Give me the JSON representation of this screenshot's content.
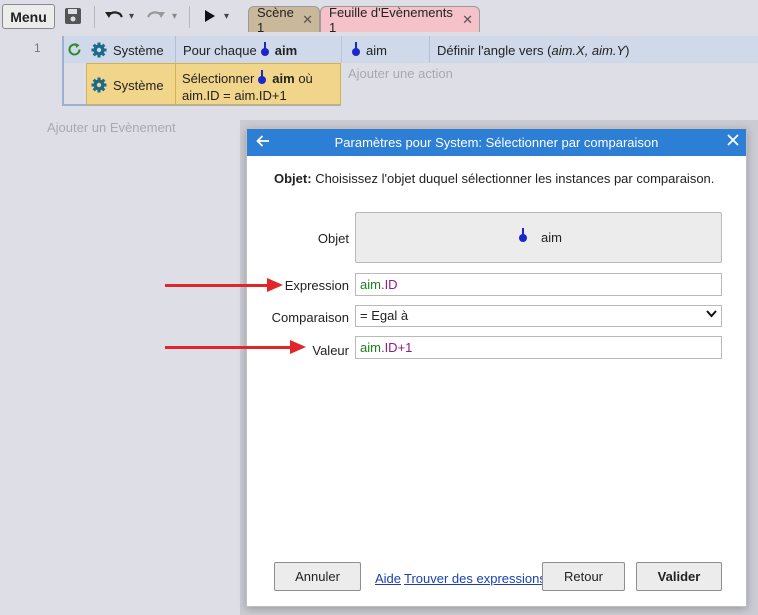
{
  "toolbar": {
    "menu_label": "Menu",
    "icons": [
      "save-icon",
      "undo-icon",
      "redo-icon",
      "play-icon"
    ],
    "tabs": [
      {
        "label": "Scène 1",
        "color": "#c9b99a"
      },
      {
        "label": "Feuille d'Evènements 1",
        "color": "#f4c2c8"
      }
    ],
    "close_glyph": "✕",
    "dropdown_glyph": "▾"
  },
  "event_sheet": {
    "line_number": "1",
    "conditions": [
      {
        "object": "Système",
        "text_before": "Pour chaque",
        "object_ref": "aim",
        "text_after": ""
      },
      {
        "object": "Système",
        "text_before": "Sélectionner",
        "object_ref": "aim",
        "text_after": "où",
        "line2": "aim.ID = aim.ID+1"
      }
    ],
    "action": {
      "object": "aim",
      "text": "Définir l'angle vers (",
      "italic": "aim.X, aim.Y",
      "text_end": ")"
    },
    "add_action": "Ajouter une action",
    "add_event": "Ajouter un Evènement"
  },
  "dialog": {
    "title": "Paramètres pour System: Sélectionner par comparaison",
    "description_bold": "Objet:",
    "description": "Choisissez l'objet duquel sélectionner les instances par comparaison.",
    "fields": {
      "object_label": "Objet",
      "object_value": "aim",
      "expression_label": "Expression",
      "expression_obj": "aim",
      "expression_rest": ".ID",
      "comparison_label": "Comparaison",
      "comparison_value": "= Egal à",
      "value_label": "Valeur",
      "value_obj": "aim",
      "value_mid": ".ID",
      "value_op": "+1"
    },
    "buttons": {
      "cancel": "Annuler",
      "help": "Aide",
      "find_expressions": "Trouver des expressions",
      "back": "Retour",
      "validate": "Valider"
    }
  },
  "colors": {
    "title_bar": "#2d7fd6",
    "condition_highlight": "#f1d58a",
    "event_row": "#cfd9e9",
    "annotation_arrow": "#e0262b"
  }
}
